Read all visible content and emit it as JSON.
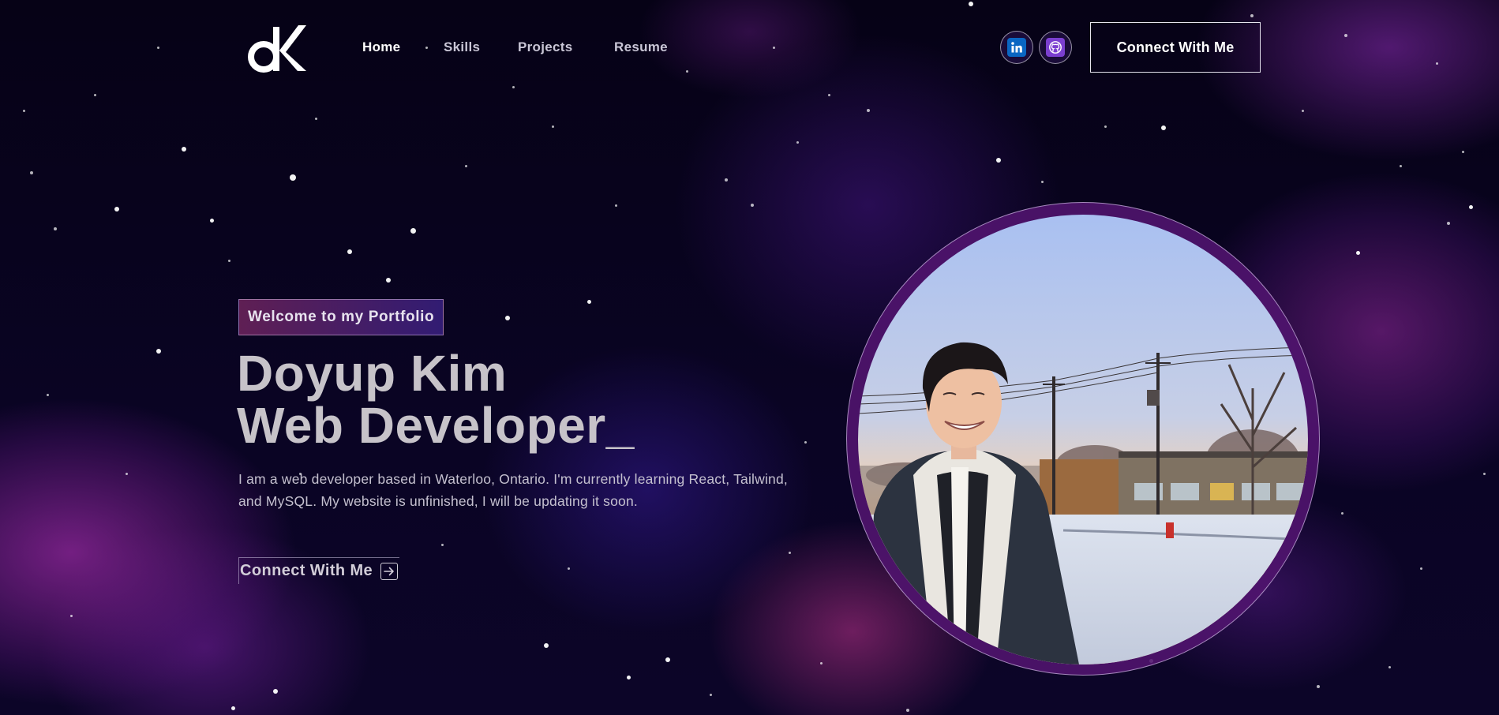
{
  "nav": {
    "logo_text": "dK",
    "links": [
      "Home",
      "Skills",
      "Projects",
      "Resume"
    ],
    "active": "Home",
    "social": [
      {
        "name": "LinkedIn",
        "icon": "linkedin-icon",
        "color": "#0a66c2"
      },
      {
        "name": "GitHub",
        "icon": "github-icon",
        "color": "#7b3fd0"
      }
    ],
    "connect_label": "Connect With Me"
  },
  "hero": {
    "tagline": "Welcome to my Portfolio",
    "name": "Doyup Kim",
    "role": "Web Developer_",
    "bio": "I am a web developer based in Waterloo, Ontario. I'm currently learning React, Tailwind, and MySQL. My website is unfinished, I will be updating it soon.",
    "cta_label": "Connect With Me",
    "cta_icon": "arrow-right-icon"
  },
  "portrait": {
    "alt": "profile-photo"
  },
  "colors": {
    "background": "#07031a",
    "accent_pink": "#aa367c",
    "accent_blue": "#4a2fbd",
    "text": "#c7c3c9"
  }
}
